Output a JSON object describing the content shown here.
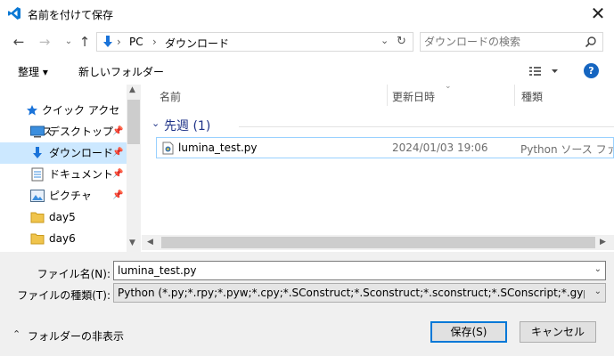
{
  "window": {
    "title": "名前を付けて保存",
    "close_glyph": "✕",
    "app_icon": "vscode-icon"
  },
  "nav": {
    "back": "←",
    "forward": "→",
    "up": "↑",
    "address": {
      "segments": [
        "PC",
        "ダウンロード"
      ],
      "separator": "›"
    },
    "search_placeholder": "ダウンロードの検索"
  },
  "toolbar": {
    "organize": "整理 ▾",
    "new_folder": "新しいフォルダー",
    "view_icon": "view-options-icon",
    "help": "?"
  },
  "sidebar": {
    "items": [
      {
        "label": "クイック アクセス",
        "icon": "star-icon",
        "pinned": false,
        "selected": false
      },
      {
        "label": "デスクトップ",
        "icon": "desktop-icon",
        "pinned": true,
        "selected": false
      },
      {
        "label": "ダウンロード",
        "icon": "download-icon",
        "pinned": true,
        "selected": true
      },
      {
        "label": "ドキュメント",
        "icon": "document-icon",
        "pinned": true,
        "selected": false
      },
      {
        "label": "ピクチャ",
        "icon": "picture-icon",
        "pinned": true,
        "selected": false
      },
      {
        "label": "day5",
        "icon": "folder-icon",
        "pinned": false,
        "selected": false
      },
      {
        "label": "day6",
        "icon": "folder-icon",
        "pinned": false,
        "selected": false
      }
    ]
  },
  "file_list": {
    "columns": [
      "名前",
      "更新日時",
      "種類"
    ],
    "group": {
      "label": "先週 (1)"
    },
    "rows": [
      {
        "name": "lumina_test.py",
        "modified": "2024/01/03 19:06",
        "type": "Python ソース ファイル"
      }
    ]
  },
  "form": {
    "filename_label": "ファイル名(N):",
    "filename_value": "lumina_test.py",
    "filetype_label": "ファイルの種類(T):",
    "filetype_value": "Python (*.py;*.rpy;*.pyw;*.cpy;*.SConstruct;*.Sconstruct;*.sconstruct;*.SConscript;*.gyp;*.gypi)"
  },
  "footer": {
    "hide_folders": "フォルダーの非表示",
    "save": "保存(S)",
    "cancel": "キャンセル"
  },
  "colors": {
    "selection": "#cce8ff",
    "accent": "#0078d7",
    "group_heading": "#1e3287"
  }
}
